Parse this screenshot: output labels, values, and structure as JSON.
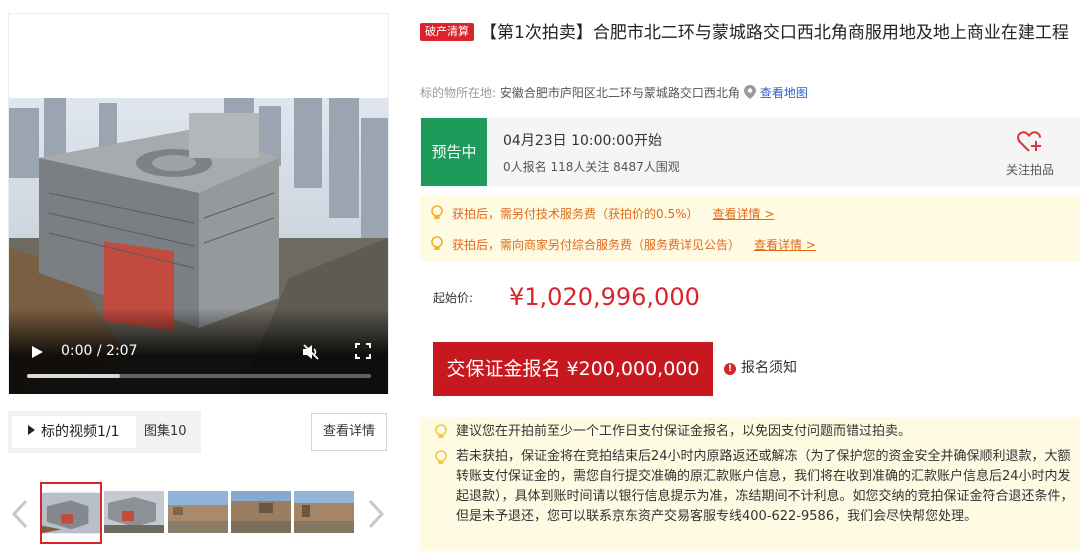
{
  "media": {
    "video": {
      "time_display": "0:00 / 2:07",
      "progress_fraction": 0.27
    },
    "tabs": {
      "video_label": "标的视频1/1",
      "gallery_label": "图集10"
    },
    "view_detail_label": "查看详情",
    "thumbnails": [
      {
        "name": "thumb-aerial-1"
      },
      {
        "name": "thumb-aerial-2"
      },
      {
        "name": "thumb-ground-1"
      },
      {
        "name": "thumb-ground-2"
      },
      {
        "name": "thumb-ground-3"
      }
    ],
    "active_thumbnail_index": 0
  },
  "listing": {
    "badge": "破产清算",
    "title": "【第1次拍卖】合肥市北二环与蒙城路交口西北角商服用地及地上商业在建工程",
    "location_label": "标的物所在地:",
    "location_value": "安徽合肥市庐阳区北二环与蒙城路交口西北角",
    "map_link": "查看地图"
  },
  "status": {
    "badge": "预告中",
    "badge_color": "#1e9a5a",
    "start_time": "04月23日 10:00:00开始",
    "stats": "0人报名  118人关注  8487人围观",
    "follow_label": "关注拍品"
  },
  "notices": [
    {
      "text": "获拍后，需另付技术服务费（获拍价的0.5%）",
      "link": "查看详情 >"
    },
    {
      "text": "获拍后，需向商家另付综合服务费（服务费详见公告）",
      "link": "查看详情 >"
    }
  ],
  "price": {
    "label": "起始价:",
    "value": "¥1,020,996,000"
  },
  "actions": {
    "deposit_button": "交保证金报名 ¥200,000,000",
    "registration_notice": "报名须知"
  },
  "advice": [
    "建议您在开拍前至少一个工作日支付保证金报名，以免因支付问题而错过拍卖。",
    "若未获拍，保证金将在竞拍结束后24小时内原路返还或解冻（为了保护您的资金安全并确保顺利退款，大额转账支付保证金的，需您自行提交准确的原汇款账户信息，我们将在收到准确的汇款账户信息后24小时内发起退款），具体到账时间请以银行信息提示为准，冻结期间不计利息。如您交纳的竞拍保证金符合退还条件，但是未予退还，您可以联系京东资产交易客服专线400-622-9586，我们会尽快帮您处理。"
  ],
  "colors": {
    "accent_red": "#d8242a",
    "notice_orange": "#e06a1a",
    "link_blue": "#2a62c9",
    "status_green": "#1e9a5a"
  }
}
